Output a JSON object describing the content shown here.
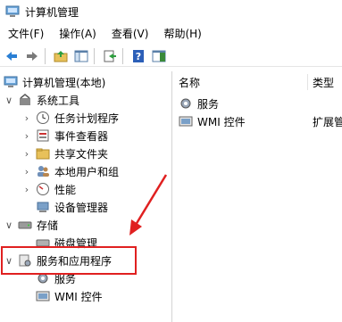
{
  "window": {
    "title": "计算机管理"
  },
  "menu": [
    "文件(F)",
    "操作(A)",
    "查看(V)",
    "帮助(H)"
  ],
  "toolbar": {
    "buttons": [
      "back-icon",
      "forward-icon",
      "up-folder-icon",
      "show-hide-tree-icon",
      "export-list-icon",
      "help-icon",
      "action-pane-icon"
    ]
  },
  "tree": {
    "root": "计算机管理(本地)",
    "system_tools": "系统工具",
    "task_scheduler": "任务计划程序",
    "event_viewer": "事件查看器",
    "shared_folders": "共享文件夹",
    "local_users": "本地用户和组",
    "performance": "性能",
    "device_manager": "设备管理器",
    "storage": "存储",
    "disk_management": "磁盘管理",
    "services_apps": "服务和应用程序",
    "services": "服务",
    "wmi": "WMI 控件"
  },
  "list": {
    "col_name": "名称",
    "col_type": "类型",
    "rows": [
      {
        "name": "服务",
        "type": ""
      },
      {
        "name": "WMI 控件",
        "type": "扩展管"
      }
    ]
  },
  "colors": {
    "highlight": "#e02020",
    "accent": "#1e6fd9"
  }
}
